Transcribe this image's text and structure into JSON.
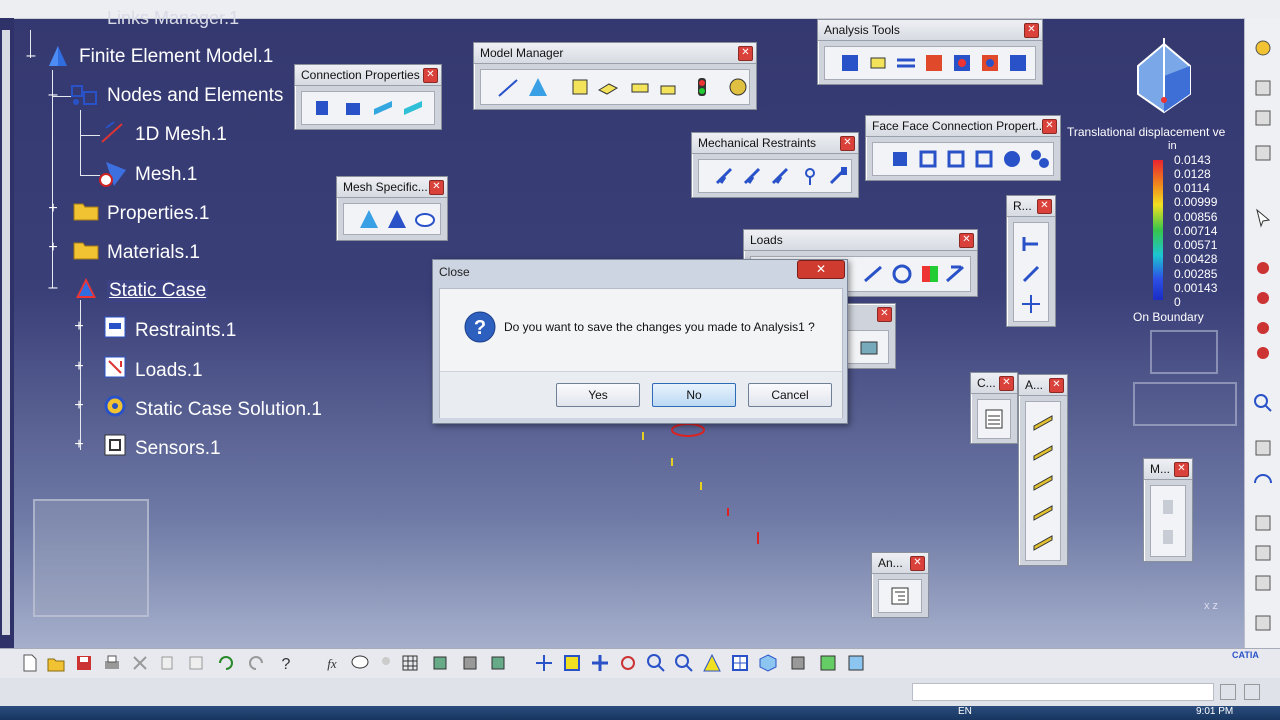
{
  "tree": {
    "top_label": "Links Manager.1",
    "items": [
      {
        "label": "Finite Element Model.1",
        "icon": "fem-model-icon"
      },
      {
        "label": "Nodes and Elements",
        "icon": "nodes-elements-icon"
      },
      {
        "label": "1D Mesh.1",
        "icon": "mesh-1d-icon"
      },
      {
        "label": "Mesh.1",
        "icon": "mesh-icon"
      },
      {
        "label": "Properties.1",
        "icon": "folder-icon"
      },
      {
        "label": "Materials.1",
        "icon": "folder-icon"
      },
      {
        "label": "Static Case",
        "icon": "static-case-icon"
      },
      {
        "label": "Restraints.1",
        "icon": "restraints-icon"
      },
      {
        "label": "Loads.1",
        "icon": "loads-icon"
      },
      {
        "label": "Static Case Solution.1",
        "icon": "solution-icon"
      },
      {
        "label": "Sensors.1",
        "icon": "sensors-icon"
      }
    ]
  },
  "toolbars": {
    "connection_properties": "Connection Properties",
    "model_manager": "Model Manager",
    "analysis_tools": "Analysis Tools",
    "mesh_specific": "Mesh Specific...",
    "mechanical_restraints": "Mechanical Restraints",
    "face_face": "Face Face Connection Propert...",
    "loads": "Loads",
    "r_small": "R...",
    "c_small": "C...",
    "a_small": "A...",
    "an_small": "An...",
    "m_small": "M..."
  },
  "dialog": {
    "title": "Close",
    "message": "Do you want to save the changes you made to Analysis1 ?",
    "yes": "Yes",
    "no": "No",
    "cancel": "Cancel"
  },
  "legend": {
    "title": "Translational displacement ve",
    "unit": "in",
    "values": [
      "0.0143",
      "0.0128",
      "0.0114",
      "0.00999",
      "0.00856",
      "0.00714",
      "0.00571",
      "0.00428",
      "0.00285",
      "0.00143",
      "0"
    ],
    "footer": "On Boundary"
  },
  "axis_glyph": "x z",
  "brand": "CATIA",
  "clock": "9:01 PM",
  "lang": "EN"
}
